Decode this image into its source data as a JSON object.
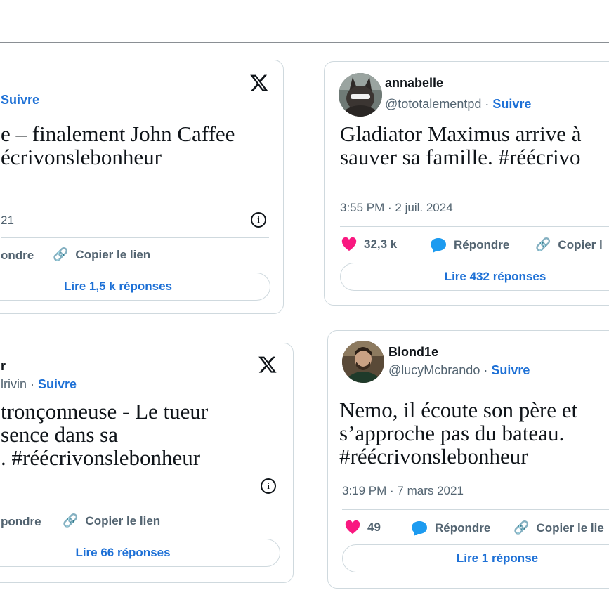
{
  "tweets": [
    {
      "name": "",
      "handle": "",
      "follow": "Suivre",
      "text_lines": [
        "e – finalement John Caffee",
        "écrivonslebonheur"
      ],
      "time": "21",
      "reply": "ondre",
      "copy": "Copier le lien",
      "read": "Lire 1,5 k réponses"
    },
    {
      "name": "annabelle",
      "handle": "@tototalementpd",
      "follow": "Suivre",
      "text_lines": [
        "Gladiator Maximus arrive à",
        "sauver sa famille. #réécrivo"
      ],
      "time": "3:55 PM · 2 juil. 2024",
      "likes": "32,3 k",
      "reply": "Répondre",
      "copy": "Copier l",
      "read": "Lire 432 réponses"
    },
    {
      "name": "r",
      "handle": "lrivin",
      "follow": "Suivre",
      "text_lines": [
        " tronçonneuse -  Le tueur",
        "sence dans sa",
        ". #réécrivonslebonheur"
      ],
      "reply": "pondre",
      "copy": "Copier le lien",
      "read": "Lire 66 réponses"
    },
    {
      "name": "Blond1e",
      "handle": "@lucyMcbrando",
      "follow": "Suivre",
      "text_lines": [
        "Nemo, il écoute son père et",
        "s’approche pas du bateau.",
        "#réécrivonslebonheur"
      ],
      "time": "3:19 PM · 7 mars 2021",
      "likes": "49",
      "reply": "Répondre",
      "copy": "Copier le lie",
      "read": "Lire 1 réponse"
    }
  ],
  "colors": {
    "accent": "#1d70d6",
    "heart": "#f91880",
    "bubble": "#1d9bf0",
    "border": "#cfd9de"
  }
}
